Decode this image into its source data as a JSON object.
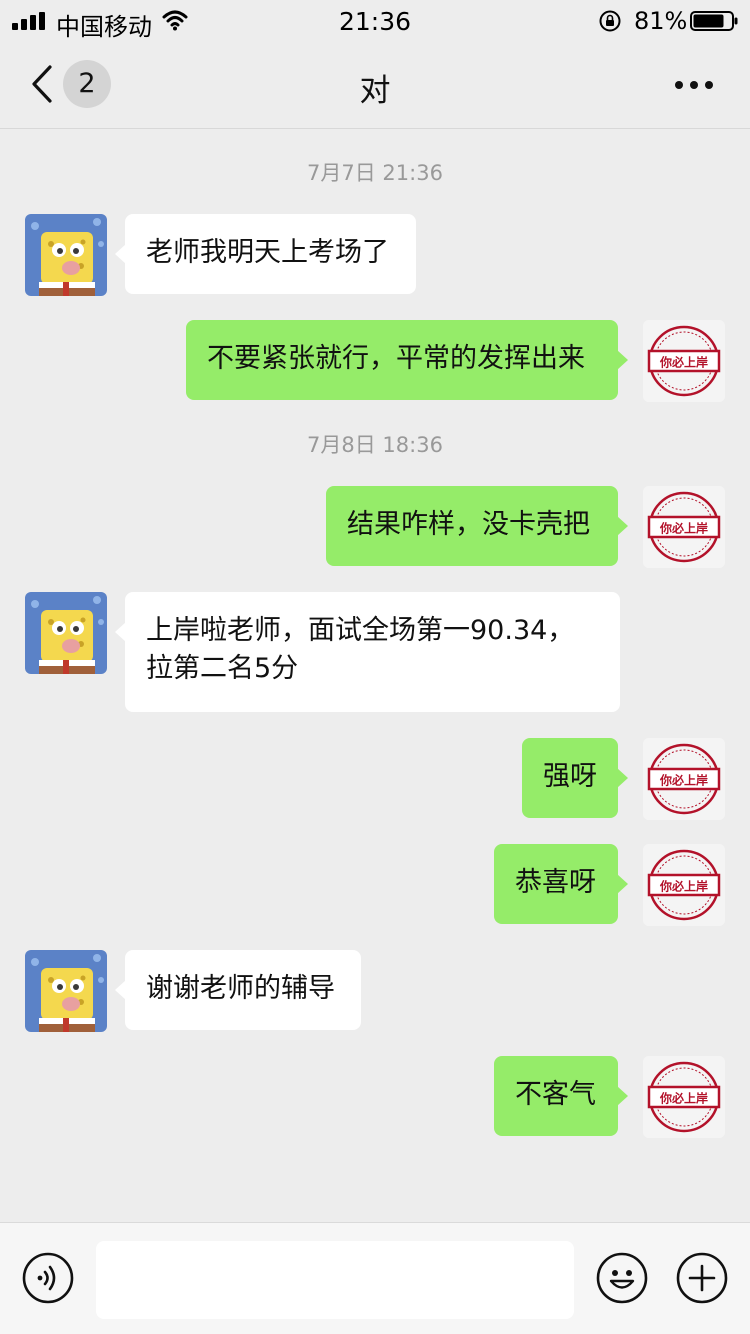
{
  "status_bar": {
    "carrier": "中国移动",
    "time": "21:36",
    "battery_percent": "81%",
    "battery_level": 0.81
  },
  "nav": {
    "unread_count": "2",
    "title": "对"
  },
  "chat": {
    "timestamps": [
      "7月7日 21:36",
      "7月8日 18:36"
    ],
    "messages": [
      {
        "direction": "in",
        "text": "老师我明天上考场了"
      },
      {
        "direction": "out",
        "text": "不要紧张就行，平常的发挥出来"
      },
      {
        "direction": "out",
        "text": "结果咋样，没卡壳把"
      },
      {
        "direction": "in",
        "text_line1": "上岸啦老师，面试全场第一90.34，",
        "text_line2": "拉第二名5分"
      },
      {
        "direction": "out",
        "text": "强呀"
      },
      {
        "direction": "out",
        "text": "恭喜呀"
      },
      {
        "direction": "in",
        "text": "谢谢老师的辅导"
      },
      {
        "direction": "out",
        "text": "不客气"
      }
    ],
    "own_avatar_stamp_text": "你必上岸"
  },
  "input_bar": {
    "placeholder": ""
  },
  "icons": {
    "signal": "signal-icon",
    "wifi": "wifi-icon",
    "orientation_lock": "orientation-lock-icon",
    "battery": "battery-icon",
    "back": "chevron-left-icon",
    "more": "more-icon",
    "voice": "voice-icon",
    "emoji": "emoji-icon",
    "plus": "plus-icon"
  },
  "colors": {
    "background": "#ededed",
    "outgoing_bubble": "#95ec69",
    "incoming_bubble": "#ffffff",
    "timestamp_text": "#999999",
    "stamp_red": "#b3122a"
  }
}
